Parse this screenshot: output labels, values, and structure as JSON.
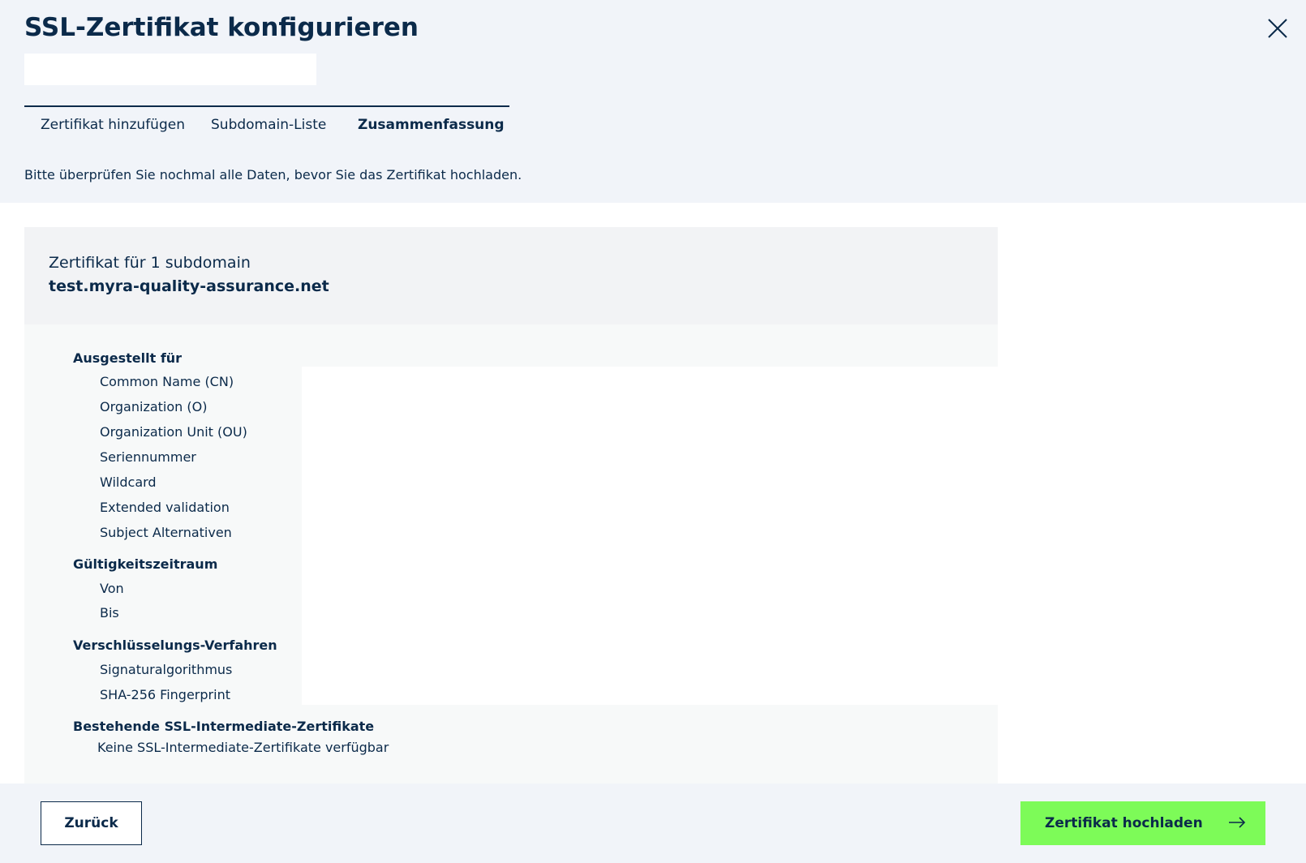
{
  "header": {
    "title": "SSL-Zertifikat konfigurieren",
    "intro": "Bitte überprüfen Sie nochmal alle Daten, bevor Sie das Zertifikat hochladen."
  },
  "tabs": [
    {
      "label": "Zertifikat hinzufügen",
      "active": false
    },
    {
      "label": "Subdomain-Liste",
      "active": false
    },
    {
      "label": "Zusammenfassung",
      "active": true
    }
  ],
  "summary": {
    "label": "Zertifikat für 1 subdomain",
    "domain": "test.myra-quality-assurance.net"
  },
  "details": {
    "issued_for": {
      "title": "Ausgestellt für",
      "fields": [
        "Common Name (CN)",
        "Organization (O)",
        "Organization Unit (OU)",
        "Seriennummer",
        "Wildcard",
        "Extended validation",
        "Subject Alternativen"
      ]
    },
    "validity": {
      "title": "Gültigkeitszeitraum",
      "fields": [
        "Von",
        "Bis"
      ]
    },
    "encryption": {
      "title": "Verschlüsselungs-Verfahren",
      "fields": [
        "Signaturalgorithmus",
        "SHA-256 Fingerprint"
      ]
    },
    "intermediate": {
      "title": "Bestehende SSL-Intermediate-Zertifikate",
      "empty_text": "Keine SSL-Intermediate-Zertifikate verfügbar"
    }
  },
  "footer": {
    "back_label": "Zurück",
    "upload_label": "Zertifikat hochladen"
  },
  "colors": {
    "primary": "#0b2a4a",
    "accent": "#7dfb58",
    "header_bg": "#f1f4f9"
  },
  "icons": {
    "close": "close-icon",
    "arrow": "arrow-right-icon"
  }
}
